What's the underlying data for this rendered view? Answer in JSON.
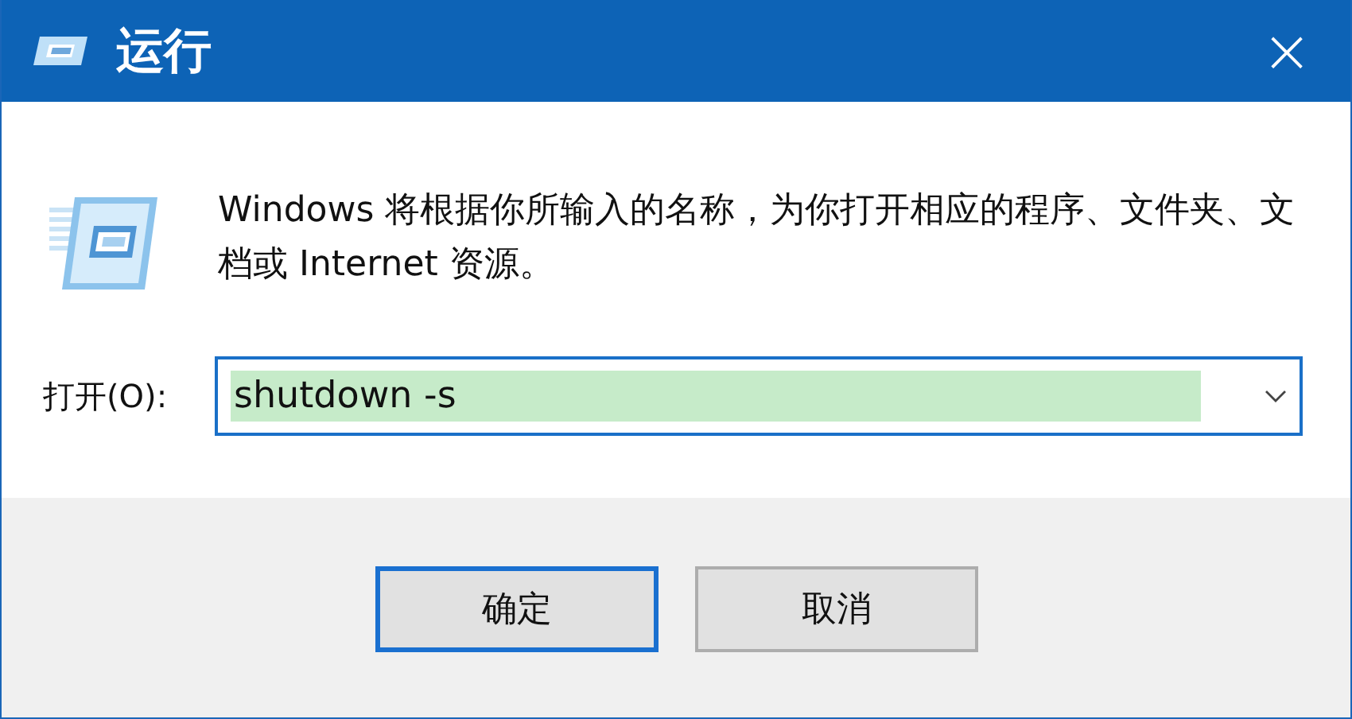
{
  "window": {
    "title": "运行",
    "close": "×"
  },
  "description": "Windows 将根据你所输入的名称，为你打开相应的程序、文件夹、文档或 Internet 资源。",
  "open_field": {
    "label": "打开(O):",
    "value": "shutdown -s",
    "selected": true
  },
  "buttons": [
    {
      "label": "确定",
      "default": true
    },
    {
      "label": "取消",
      "default": false
    }
  ]
}
